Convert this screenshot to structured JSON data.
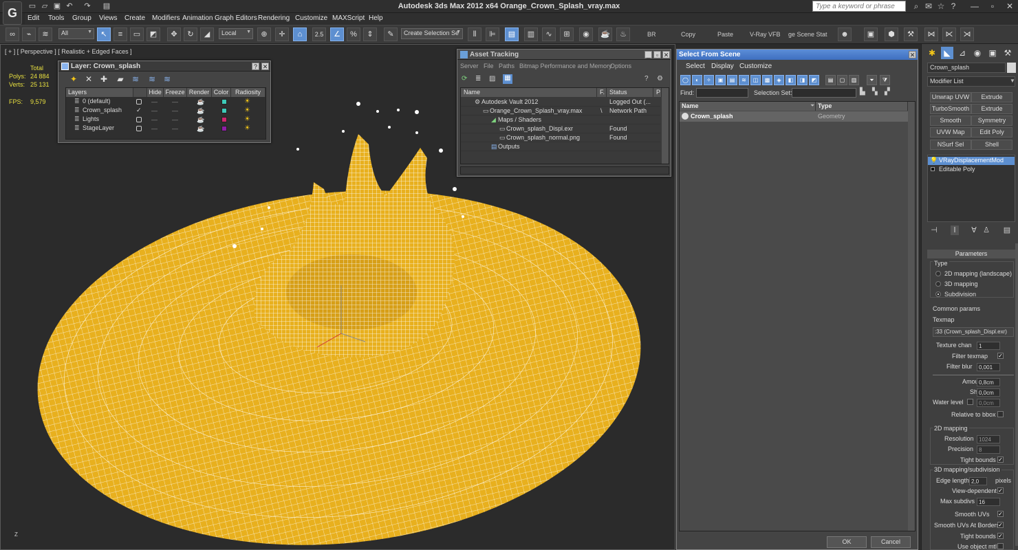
{
  "app": {
    "title": "Autodesk 3ds Max  2012 x64      Orange_Crown_Splash_vray.max",
    "search_placeholder": "Type a keyword or phrase"
  },
  "menu": [
    "Edit",
    "Tools",
    "Group",
    "Views",
    "Create",
    "Modifiers",
    "Animation",
    "Graph Editors",
    "Rendering",
    "Customize",
    "MAXScript",
    "Help"
  ],
  "toolbar": {
    "filter": "All",
    "coord": "Local",
    "snap_value": "2.5",
    "selection_set": "Create Selection Se",
    "br": "BR",
    "copy": "Copy",
    "paste": "Paste",
    "vray_vfb": "V-Ray VFB",
    "stage": "ge Scene Stat"
  },
  "viewport": {
    "label": "[ + ] [ Perspective ] [ Realistic + Edged Faces ]",
    "total": "Total",
    "polys_label": "Polys:",
    "polys": "24 884",
    "verts_label": "Verts:",
    "verts": "25 131",
    "fps_label": "FPS:",
    "fps": "9,579",
    "axis": "Z",
    "colors": {
      "mesh_fill": "#e8b01e",
      "wire": "#ffffff",
      "background": "#2b2b2b"
    }
  },
  "layer_window": {
    "title": "Layer: Crown_splash",
    "headers": [
      "Layers",
      "Hide",
      "Freeze",
      "Render",
      "Color",
      "Radiosity"
    ],
    "rows": [
      {
        "name": "0 (default)",
        "color": "#3dcbb9",
        "active": false
      },
      {
        "name": "Crown_splash",
        "color": "#3dcbb9",
        "active": true
      },
      {
        "name": "Lights",
        "color": "#d0266e",
        "active": false
      },
      {
        "name": "StageLayer",
        "color": "#8e1ea6",
        "active": false
      }
    ]
  },
  "asset_window": {
    "title": "Asset Tracking",
    "menu": [
      "Server",
      "File",
      "Paths",
      "Bitmap Performance and Memory",
      "Options"
    ],
    "headers": [
      "Name",
      "F.",
      "Status",
      "P"
    ],
    "rows": [
      {
        "name": "Autodesk Vault 2012",
        "f": "",
        "status": "Logged Out (..."
      },
      {
        "name": "Orange_Crown_Splash_vray.max",
        "f": "\\",
        "status": "Network Path"
      },
      {
        "name": "Maps / Shaders",
        "f": "",
        "status": ""
      },
      {
        "name": "Crown_splash_Displ.exr",
        "f": "",
        "status": "Found"
      },
      {
        "name": "Crown_splash_normal.png",
        "f": "",
        "status": "Found"
      },
      {
        "name": "Outputs",
        "f": "",
        "status": ""
      }
    ]
  },
  "select_window": {
    "title": "Select From Scene",
    "menu": [
      "Select",
      "Display",
      "Customize"
    ],
    "find_label": "Find:",
    "selection_set_label": "Selection Set:",
    "headers": [
      "Name",
      "Type"
    ],
    "rows": [
      {
        "name": "Crown_splash",
        "type": "Geometry"
      }
    ],
    "ok": "OK",
    "cancel": "Cancel"
  },
  "command_panel": {
    "object_name": "Crown_splash",
    "modifier_list": "Modifier List",
    "buttons": [
      "Unwrap UVW",
      "Extrude",
      "TurboSmooth",
      "Extrude",
      "Smooth",
      "Symmetry",
      "UVW Map",
      "Edit Poly",
      "NSurf Sel",
      "Shell"
    ],
    "stack": [
      "VRayDisplacementMod",
      "Editable Poly"
    ],
    "parameters": "Parameters",
    "type_label": "Type",
    "type_2d": "2D mapping (landscape)",
    "type_3d": "3D mapping",
    "type_sub": "Subdivision",
    "common_params": "Common params",
    "texmap_label": "Texmap",
    "texmap_value": ":33 (Crown_splash_Displ.exr)",
    "texture_chan_label": "Texture chan",
    "texture_chan": "1",
    "filter_texmap": "Filter texmap",
    "filter_blur_label": "Filter blur",
    "filter_blur": "0,001",
    "amount_label": "Amount",
    "amount": "0,8cm",
    "shift_label": "Shift",
    "shift": "0,0cm",
    "water_level_label": "Water level",
    "water_level": "0,0cm",
    "relative_bbox": "Relative to bbox",
    "mapping_2d": "2D mapping",
    "resolution_label": "Resolution",
    "resolution": "1024",
    "precision_label": "Precision",
    "precision": "8",
    "tight_bounds": "Tight bounds",
    "mapping_3d": "3D mapping/subdivision",
    "edge_length_label": "Edge length",
    "edge_length": "2,0",
    "pixels": "pixels",
    "view_dependent": "View-dependent",
    "max_subdivs_label": "Max subdivs",
    "max_subdivs": "16",
    "smooth_uvs": "Smooth UVs",
    "smooth_uvs_borders": "Smooth UVs At Borders",
    "tight_bounds2": "Tight bounds",
    "use_object_mtl": "Use object mtl"
  }
}
